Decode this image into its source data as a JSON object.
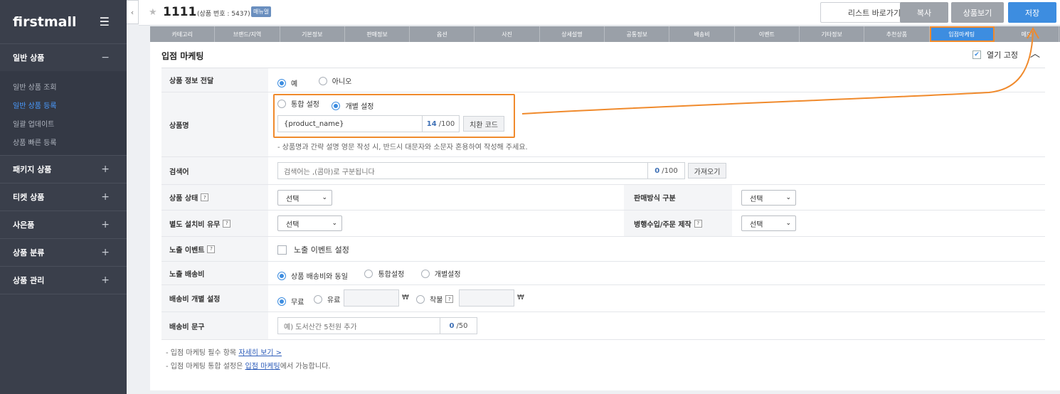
{
  "sidebar": {
    "logo": "firstmall",
    "groups": [
      {
        "label": "일반 상품",
        "sign": "−",
        "items": [
          "일반 상품 조회",
          "일반 상품 등록",
          "일괄 업데이트",
          "상품 빠른 등록"
        ]
      },
      {
        "label": "패키지 상품",
        "sign": "+"
      },
      {
        "label": "티켓 상품",
        "sign": "+"
      },
      {
        "label": "사은품",
        "sign": "+"
      },
      {
        "label": "상품 분류",
        "sign": "+"
      },
      {
        "label": "상품 관리",
        "sign": "+"
      }
    ]
  },
  "header": {
    "title": "1111",
    "product_no": "(상품 번호 : 5437)",
    "manual": "매뉴얼",
    "btn_list": "리스트 바로가기",
    "btn_copy": "복사",
    "btn_view": "상품보기",
    "btn_save": "저장"
  },
  "tabs": [
    "카테고리",
    "브랜드/지역",
    "기본정보",
    "판매정보",
    "옵션",
    "사진",
    "상세설명",
    "공통정보",
    "배송비",
    "이벤트",
    "기타정보",
    "추천상품",
    "입점마케팅",
    "메모"
  ],
  "section": {
    "title": "입점 마케팅",
    "fix_open": "열기 고정"
  },
  "form": {
    "info_transfer": {
      "label": "상품 정보 전달",
      "yes": "예",
      "no": "아니오"
    },
    "product_name": {
      "label": "상품명",
      "opt_all": "통합 설정",
      "opt_each": "개별 설정",
      "value": "{product_name}",
      "count": "14",
      "max": "/100",
      "replace_btn": "치환 코드",
      "note": "-  상품명과 간략 설명 영문 작성 시, 반드시 대문자와 소문자 혼용하여 작성해 주세요."
    },
    "keyword": {
      "label": "검색어",
      "placeholder": "검색어는 ,(콤마)로 구분됩니다",
      "count": "0",
      "max": "/100",
      "fetch_btn": "가져오기"
    },
    "status": {
      "label": "상품 상태",
      "select": "선택"
    },
    "sale_type": {
      "label": "판매방식 구분",
      "select": "선택"
    },
    "install_fee": {
      "label": "별도 설치비 유무",
      "select": "선택"
    },
    "import_type": {
      "label": "병행수입/주문 제작",
      "select": "선택"
    },
    "event": {
      "label": "노출 이벤트",
      "checkbox": "노출 이벤트 설정"
    },
    "shipping": {
      "label": "노출 배송비",
      "opt1": "상품 배송비와 동일",
      "opt2": "통합설정",
      "opt3": "개별설정"
    },
    "shipping_each": {
      "label": "배송비 개별 설정",
      "free": "무료",
      "paid": "유료",
      "cod": "착불",
      "won": "₩"
    },
    "shipping_text": {
      "label": "배송비 문구",
      "placeholder": "예) 도서산간 5천원 추가",
      "count": "0",
      "max": "/50"
    }
  },
  "footer": {
    "note1_prefix": "-  입점 마케팅 필수 항목 ",
    "note1_link": "자세히 보기 >",
    "note2_prefix": "-  입점 마케팅 통합 설정은 ",
    "note2_link": "입점 마케팅",
    "note2_suffix": "에서 가능합니다."
  },
  "colors": {
    "accent": "#3d8de0",
    "highlight": "#f08a2c",
    "sidebar": "#3a3f4b"
  }
}
